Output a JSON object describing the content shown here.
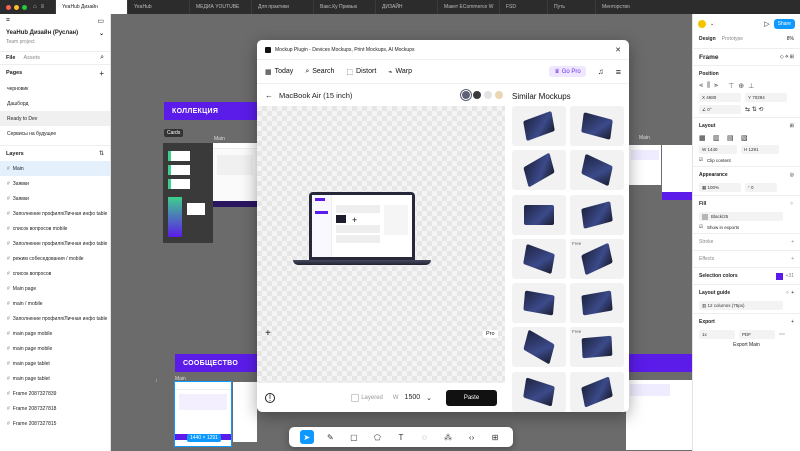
{
  "tabs": [
    {
      "label": "YeaHub Дизайн"
    },
    {
      "label": "YeaHub"
    },
    {
      "label": "МЕДИА YOUTUBE"
    },
    {
      "label": "Для практики"
    },
    {
      "label": "Вакс.Ку Привью"
    },
    {
      "label": "ДИЗАЙН"
    },
    {
      "label": "Макет ECommerce W"
    },
    {
      "label": "FSD"
    },
    {
      "label": "Путь"
    },
    {
      "label": "Менторство"
    }
  ],
  "left": {
    "project_title": "YeaHub Дизайн (Руслан)",
    "project_sub": "Team project",
    "tab_file": "File",
    "tab_assets": "Assets",
    "pages_label": "Pages",
    "pages": [
      "черновик",
      "Дашборд",
      "Ready to Dev",
      "Сервисы на будущее"
    ],
    "layers_label": "Layers",
    "layers": [
      "Main",
      "Заявки",
      "Заявки",
      "Заполнение профиля/Личная инфо table",
      "список вопросов mobile",
      "Заполнение профиля/Личная инфо table",
      "режим собеседования / mobile",
      "список вопросов",
      "Main page",
      "main / mobile",
      "Заполнение профиля/Личная инфо table",
      "main page mobile",
      "main page mobile",
      "main page tablet",
      "main page tablet",
      "Frame 2087327839",
      "Frame 2087327818",
      "Frame 2087327815"
    ]
  },
  "canvas": {
    "band1": "КОЛЛЕКЦИЯ",
    "band2": "СООБЩЕСТВО",
    "label_cards": "Cards",
    "label_main": "Main",
    "label_main2": "Main",
    "size_badge": "1440 × 1291"
  },
  "modal": {
    "header": "Mockup Plugin - Devices Mockups, Print Mockups, AI Mockups",
    "nav": [
      "Today",
      "Search",
      "Distort",
      "Warp"
    ],
    "gopro": "Go Pro",
    "device": "MacBook Air (15 inch)",
    "similar": "Similar Mockups",
    "pro_badge": "Pro",
    "free_badge": "Free",
    "layered": "Layered",
    "w_label": "W",
    "w_value": "1500",
    "paste": "Paste",
    "swatches": [
      "#5e6274",
      "#3a3a3c",
      "#e3e3e3",
      "#e8d6b4"
    ]
  },
  "right": {
    "tab_design": "Design",
    "tab_prototype": "Prototype",
    "zoom": "8%",
    "share": "Share",
    "frame": "Frame",
    "position": "Position",
    "x": "4680",
    "y": "70294",
    "rot": "0°",
    "layout": "Layout",
    "w": "1440",
    "h": "1291",
    "clip": "Clip content",
    "appearance": "Appearance",
    "opacity": "100%",
    "radius": "0",
    "fill": "Fill",
    "fill_name": "Black/25",
    "show_exports": "Show in exports",
    "stroke": "Stroke",
    "effects": "Effects",
    "selection_colors": "Selection colors",
    "sel_count": "+31",
    "layout_guide": "Layout guide",
    "columns": "12 columns (75px)",
    "export": "Export",
    "export_scale": "1x",
    "export_format": "PDF",
    "export_main": "Export Main"
  },
  "colors": {
    "accent": "#0d99ff",
    "purple": "#5b1ce9",
    "gopro": "#6b33e6"
  }
}
